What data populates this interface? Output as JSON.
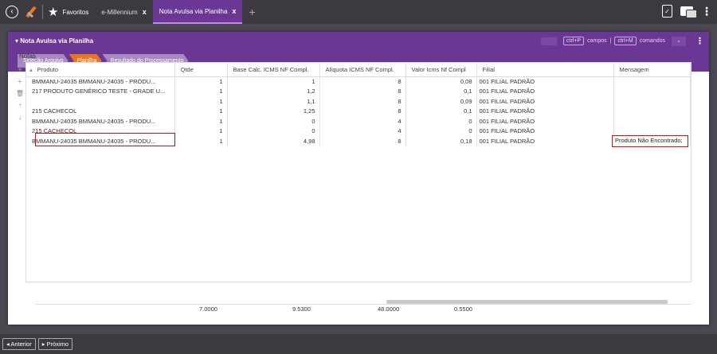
{
  "topbar": {
    "back_icon": "back-circle-icon",
    "logo_icon": "e-millennium-logo-icon",
    "star_icon": "star-icon",
    "tabs": [
      {
        "label": "Favoritos",
        "close": ""
      },
      {
        "label": "e-Millennium",
        "close": "x"
      },
      {
        "label": "Nota Avulsa via Planilha",
        "close": "x"
      }
    ],
    "plus": "+"
  },
  "panel": {
    "title": "▾ Nota Avulsa via Planilha",
    "shortcut_campos_key": "ctrl+P",
    "shortcut_campos_label": "campos",
    "separator": "|",
    "shortcut_comandos_key": "ctrl+M",
    "shortcut_comandos_label": "comandos",
    "dropdown_arrow": "⌄",
    "kebab": "⋮",
    "steps": [
      {
        "label": "Seleção Arquivo"
      },
      {
        "label": "Planilha"
      },
      {
        "label": "Resultado do Processamento"
      }
    ],
    "section_label": "Notas"
  },
  "grid": {
    "columns": [
      "Produto",
      "Qtde",
      "Base Calc. ICMS NF Compl.",
      "Alíquota ICMS NF Compl.",
      "Valor Icms Nf Compl",
      "Filial",
      "Mensagem"
    ],
    "sort_glyph": "▴",
    "tools": [
      "▾",
      "+",
      "🗑",
      "↑",
      "↓"
    ],
    "rows": [
      {
        "produto": "BMMANU-24035 BMMANU-24035 - PRODU...",
        "qtde": "1",
        "base": "1",
        "aliquota": "8",
        "valor": "0,08",
        "filial": "001 FILIAL PADRÃO",
        "mensagem": ""
      },
      {
        "produto": "217 PRODUTO GENÉRICO TESTE - GRADE U...",
        "qtde": "1",
        "base": "1,2",
        "aliquota": "8",
        "valor": "0,1",
        "filial": "001 FILIAL PADRÃO",
        "mensagem": ""
      },
      {
        "produto": "",
        "qtde": "1",
        "base": "1,1",
        "aliquota": "8",
        "valor": "0,09",
        "filial": "001 FILIAL PADRÃO",
        "mensagem": "Produto Não Encontrado;"
      },
      {
        "produto": "215 CACHECOL",
        "qtde": "1",
        "base": "1,25",
        "aliquota": "8",
        "valor": "0,1",
        "filial": "001 FILIAL PADRÃO",
        "mensagem": ""
      },
      {
        "produto": "BMMANU-24035 BMMANU-24035 - PRODU...",
        "qtde": "1",
        "base": "0",
        "aliquota": "4",
        "valor": "0",
        "filial": "001 FILIAL PADRÃO",
        "mensagem": ""
      },
      {
        "produto": "215 CACHECOL",
        "qtde": "1",
        "base": "0",
        "aliquota": "4",
        "valor": "0",
        "filial": "001 FILIAL PADRÃO",
        "mensagem": ""
      },
      {
        "produto": "BMMANU-24035 BMMANU-24035 - PRODU...",
        "qtde": "1",
        "base": "4,98",
        "aliquota": "8",
        "valor": "0,18",
        "filial": "001 FILIAL PADRÃO",
        "mensagem": ""
      }
    ],
    "totals": {
      "qtde": "7.0000",
      "base": "9.5300",
      "aliquota": "48.0000",
      "valor": "0.5500"
    }
  },
  "footer": {
    "prev_label": "◂ Anterior",
    "next_label": "▸ Próximo"
  }
}
